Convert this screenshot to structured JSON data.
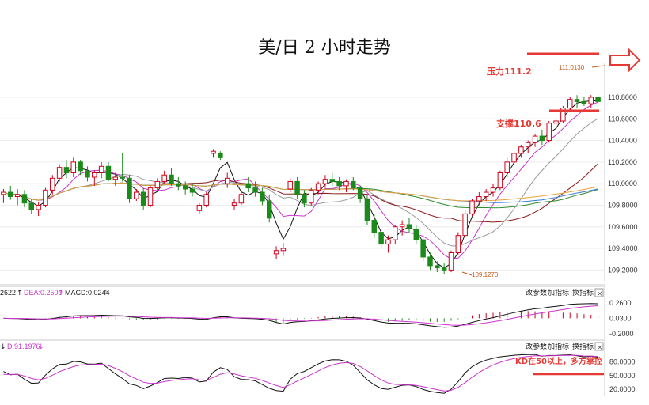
{
  "title": "美/日 2 小时走势",
  "colors": {
    "up": "#d0021b",
    "down": "#1b8a1b",
    "annotation": "#e53935",
    "ma_black": "#111111",
    "ma_magenta": "#cc33cc",
    "ma_gray": "#9a9a9a",
    "ma_darkred": "#8b1a1a",
    "ma_green": "#2e8b2e",
    "ma_blue": "#3a7bd5",
    "ma_orange": "#e8a33a"
  },
  "annotations": {
    "resistance": "压力111.2",
    "support": "支撑110.6",
    "kd_note": "KD在50以上，多方掌控",
    "high_label": "111.0130",
    "low_label": "109.1270"
  },
  "panel_buttons": {
    "params": "改参数",
    "add": "加指标",
    "switch": "换指标",
    "close": "×"
  },
  "macd_header": {
    "dif": "2622",
    "dea": "DEA:0.2500",
    "macd": "MACD:0.0244"
  },
  "kd_header": {
    "d": "D:91.1976"
  },
  "chart_data": [
    {
      "type": "candlestick",
      "title": "美/日 2 小时走势",
      "ylim": [
        109.1,
        111.1
      ],
      "y_ticks": [
        {
          "v": 110.8,
          "label": "110.8000"
        },
        {
          "v": 110.6,
          "label": "110.6000"
        },
        {
          "v": 110.4,
          "label": "110.4000"
        },
        {
          "v": 110.2,
          "label": "110.2000"
        },
        {
          "v": 110.0,
          "label": "110.0000"
        },
        {
          "v": 109.8,
          "label": "109.8000"
        },
        {
          "v": 109.6,
          "label": "109.6000"
        },
        {
          "v": 109.4,
          "label": "109.4000"
        },
        {
          "v": 109.2,
          "label": "109.2000"
        }
      ],
      "candles": [
        [
          109.9,
          109.95,
          109.82,
          109.92
        ],
        [
          109.92,
          109.98,
          109.85,
          109.88
        ],
        [
          109.88,
          109.95,
          109.8,
          109.9
        ],
        [
          109.9,
          109.94,
          109.78,
          109.82
        ],
        [
          109.82,
          109.86,
          109.72,
          109.76
        ],
        [
          109.76,
          109.83,
          109.7,
          109.8
        ],
        [
          109.8,
          109.96,
          109.78,
          109.94
        ],
        [
          109.94,
          110.08,
          109.9,
          110.05
        ],
        [
          110.05,
          110.18,
          110.02,
          110.15
        ],
        [
          110.15,
          110.22,
          110.05,
          110.1
        ],
        [
          110.1,
          110.24,
          110.06,
          110.2
        ],
        [
          110.2,
          110.22,
          110.08,
          110.12
        ],
        [
          110.12,
          110.16,
          110.02,
          110.06
        ],
        [
          110.06,
          110.12,
          109.98,
          110.1
        ],
        [
          110.1,
          110.2,
          110.05,
          110.16
        ],
        [
          110.16,
          110.2,
          110.02,
          110.04
        ],
        [
          110.04,
          110.1,
          109.98,
          110.06
        ],
        [
          110.06,
          110.28,
          110.02,
          110.05
        ],
        [
          110.05,
          110.08,
          109.82,
          109.86
        ],
        [
          109.86,
          109.95,
          109.84,
          109.92
        ],
        [
          109.92,
          109.96,
          109.76,
          109.8
        ],
        [
          109.8,
          109.98,
          109.78,
          109.96
        ],
        [
          109.96,
          110.05,
          109.92,
          110.02
        ],
        [
          110.02,
          110.12,
          110.0,
          110.08
        ],
        [
          110.08,
          110.14,
          109.98,
          110.0
        ],
        [
          110.0,
          110.06,
          109.94,
          109.98
        ],
        [
          109.98,
          110.02,
          109.9,
          109.95
        ],
        [
          109.95,
          110.0,
          109.88,
          109.92
        ],
        [
          109.75,
          109.82,
          109.72,
          109.8
        ],
        [
          109.8,
          109.92,
          109.78,
          109.9
        ],
        [
          110.28,
          110.32,
          110.24,
          110.3
        ],
        [
          110.28,
          110.3,
          110.22,
          110.24
        ],
        [
          110.0,
          110.1,
          109.96,
          110.05
        ],
        [
          109.8,
          109.86,
          109.76,
          109.82
        ],
        [
          109.82,
          109.92,
          109.8,
          109.9
        ],
        [
          110.0,
          110.06,
          109.92,
          109.96
        ],
        [
          109.96,
          110.02,
          109.88,
          109.92
        ],
        [
          109.92,
          109.96,
          109.8,
          109.84
        ],
        [
          109.84,
          109.9,
          109.64,
          109.68
        ],
        [
          109.35,
          109.42,
          109.3,
          109.38
        ],
        [
          109.38,
          109.45,
          109.33,
          109.4
        ],
        [
          109.95,
          110.05,
          109.92,
          110.02
        ],
        [
          110.02,
          110.06,
          109.86,
          109.9
        ],
        [
          109.9,
          109.94,
          109.78,
          109.82
        ],
        [
          109.82,
          109.96,
          109.8,
          109.94
        ],
        [
          109.94,
          110.02,
          109.9,
          110.0
        ],
        [
          110.0,
          110.08,
          109.96,
          110.04
        ],
        [
          110.04,
          110.1,
          109.98,
          110.02
        ],
        [
          110.02,
          110.06,
          109.94,
          109.98
        ],
        [
          109.98,
          110.04,
          109.92,
          110.02
        ],
        [
          110.02,
          110.06,
          109.94,
          109.96
        ],
        [
          109.96,
          109.98,
          109.82,
          109.86
        ],
        [
          109.86,
          109.9,
          109.62,
          109.66
        ],
        [
          109.66,
          109.72,
          109.5,
          109.55
        ],
        [
          109.55,
          109.58,
          109.4,
          109.44
        ],
        [
          109.44,
          109.52,
          109.36,
          109.48
        ],
        [
          109.48,
          109.62,
          109.44,
          109.6
        ],
        [
          109.6,
          109.66,
          109.52,
          109.62
        ],
        [
          109.62,
          109.68,
          109.54,
          109.58
        ],
        [
          109.58,
          109.62,
          109.44,
          109.48
        ],
        [
          109.48,
          109.5,
          109.28,
          109.32
        ],
        [
          109.32,
          109.36,
          109.2,
          109.24
        ],
        [
          109.24,
          109.28,
          109.18,
          109.22
        ],
        [
          109.22,
          109.26,
          109.16,
          109.2
        ],
        [
          109.2,
          109.38,
          109.18,
          109.36
        ],
        [
          109.36,
          109.55,
          109.34,
          109.52
        ],
        [
          109.52,
          109.75,
          109.5,
          109.72
        ],
        [
          109.72,
          109.86,
          109.7,
          109.84
        ],
        [
          109.84,
          109.92,
          109.8,
          109.88
        ],
        [
          109.88,
          109.95,
          109.84,
          109.92
        ],
        [
          109.92,
          110.0,
          109.88,
          109.96
        ],
        [
          109.96,
          110.12,
          109.94,
          110.1
        ],
        [
          110.1,
          110.24,
          110.06,
          110.2
        ],
        [
          110.2,
          110.3,
          110.16,
          110.28
        ],
        [
          110.28,
          110.36,
          110.24,
          110.34
        ],
        [
          110.34,
          110.4,
          110.28,
          110.38
        ],
        [
          110.38,
          110.46,
          110.34,
          110.44
        ],
        [
          110.44,
          110.5,
          110.36,
          110.4
        ],
        [
          110.4,
          110.58,
          110.38,
          110.56
        ],
        [
          110.56,
          110.62,
          110.5,
          110.58
        ],
        [
          110.58,
          110.72,
          110.56,
          110.7
        ],
        [
          110.7,
          110.8,
          110.66,
          110.78
        ],
        [
          110.78,
          110.82,
          110.7,
          110.76
        ],
        [
          110.76,
          110.8,
          110.72,
          110.74
        ],
        [
          110.74,
          110.82,
          110.7,
          110.8
        ],
        [
          110.8,
          110.83,
          110.72,
          110.76
        ]
      ]
    },
    {
      "type": "line",
      "title": "MACD",
      "ylim": [
        -0.25,
        0.32
      ],
      "y_ticks": [
        {
          "v": 0.26,
          "label": "0.2600"
        },
        {
          "v": 0.03,
          "label": "0.0300"
        },
        {
          "v": -0.2,
          "label": "-0.2000"
        }
      ]
    },
    {
      "type": "line",
      "title": "KD",
      "ylim": [
        10,
        100
      ],
      "y_ticks": [
        {
          "v": 80,
          "label": "80.0000"
        },
        {
          "v": 50,
          "label": "50.0000"
        },
        {
          "v": 20,
          "label": "20.0000"
        }
      ]
    }
  ]
}
